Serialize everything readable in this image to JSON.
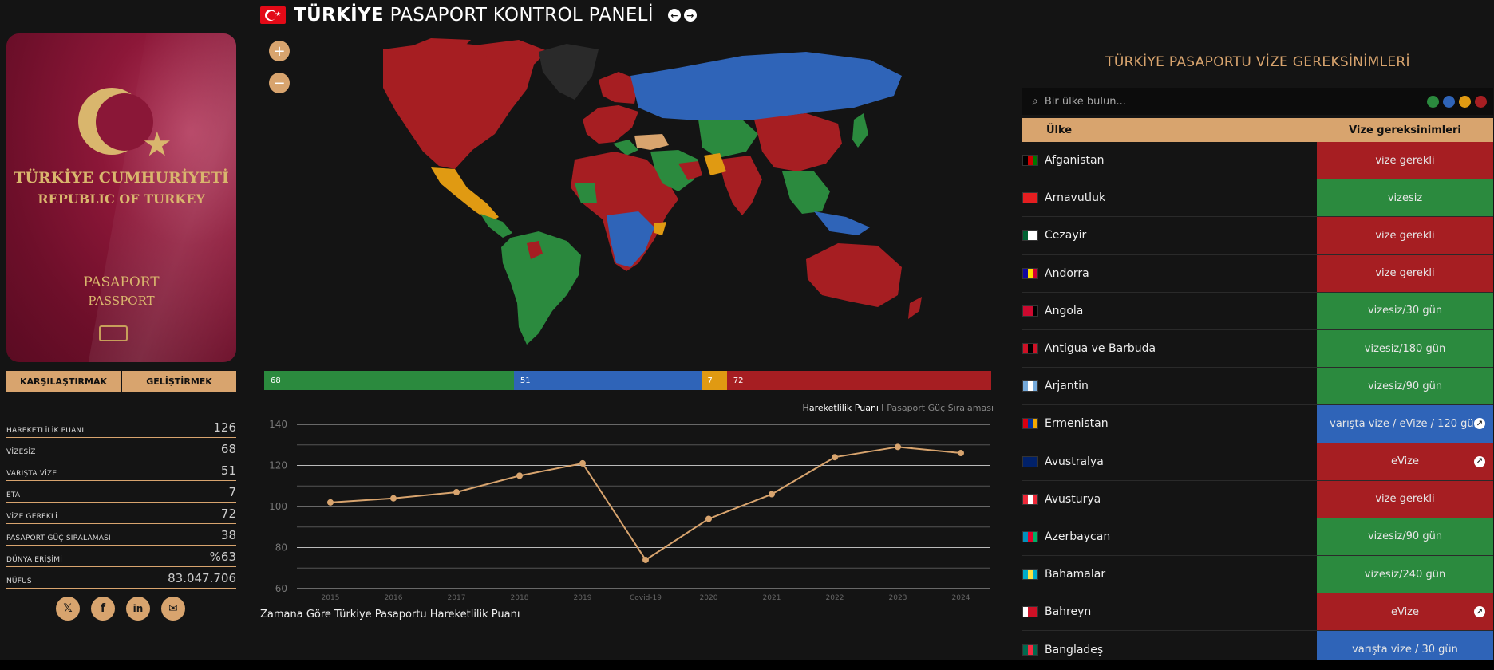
{
  "header": {
    "title_bold": "TÜRKİYE",
    "title_rest": "PASAPORT KONTROL PANELİ"
  },
  "passport": {
    "line1": "TÜRKİYE CUMHURİYETİ",
    "line2": "REPUBLIC OF TURKEY",
    "line3": "PASAPORT",
    "line4": "PASSPORT"
  },
  "actions": {
    "compare": "KARŞILAŞTIRMAK",
    "improve": "GELİŞTİRMEK"
  },
  "stats": [
    {
      "label": "HAREKETLİLİK PUANI",
      "value": "126"
    },
    {
      "label": "VİZESİZ",
      "value": "68"
    },
    {
      "label": "VARIŞTA VİZE",
      "value": "51"
    },
    {
      "label": "ETA",
      "value": "7"
    },
    {
      "label": "VİZE GEREKLİ",
      "value": "72"
    },
    {
      "label": "PASAPORT GÜÇ SIRALAMASI",
      "value": "38"
    },
    {
      "label": "DÜNYA ERİŞİMİ",
      "value": "%63"
    },
    {
      "label": "NÜFUS",
      "value": "83.047.706"
    }
  ],
  "socials": [
    "x-icon",
    "facebook-icon",
    "linkedin-icon",
    "mail-icon"
  ],
  "map": {
    "zoom_in": "+",
    "zoom_out": "−"
  },
  "breakdown": [
    {
      "label": "68",
      "value": 68,
      "color": "#2b8a3e"
    },
    {
      "label": "51",
      "value": 51,
      "color": "#2f64b8"
    },
    {
      "label": "7",
      "value": 7,
      "color": "#e09a12"
    },
    {
      "label": "72",
      "value": 72,
      "color": "#a61e22"
    }
  ],
  "chart_legend": {
    "active": "Hareketlilik Puanı",
    "separator": " I ",
    "inactive": "Pasaport Güç Sıralaması"
  },
  "chart_caption": "Zamana Göre Türkiye Pasaportu Hareketlilik Puanı",
  "chart_data": {
    "type": "line",
    "categories": [
      "2015",
      "2016",
      "2017",
      "2018",
      "2019",
      "Covid-19",
      "2020",
      "2021",
      "2022",
      "2023",
      "2024"
    ],
    "series": [
      {
        "values": [
          102,
          104,
          107,
          115,
          121,
          74,
          94,
          106,
          124,
          129,
          126
        ]
      }
    ],
    "ylim": [
      60,
      140
    ],
    "yticks": [
      60,
      80,
      100,
      120,
      140
    ],
    "grid": true,
    "color": "#d8a46e"
  },
  "table": {
    "title": "TÜRKİYE PASAPORTU VİZE GEREKSİNİMLERİ",
    "search_placeholder": "Bir ülke bulun...",
    "filter_colors": [
      "#2b8a3e",
      "#2f64b8",
      "#e09a12",
      "#a61e22"
    ],
    "col_country": "Ülke",
    "col_visa": "Vize gereksinimleri",
    "rows": [
      {
        "country": "Afganistan",
        "visa": "vize gerekli",
        "color": "#a61e22",
        "ext": false,
        "flag": [
          "#000",
          "#c00",
          "#070"
        ]
      },
      {
        "country": "Arnavutluk",
        "visa": "vizesiz",
        "color": "#2b8a3e",
        "ext": false,
        "flag": [
          "#e41e20",
          "#e41e20",
          "#e41e20"
        ]
      },
      {
        "country": "Cezayir",
        "visa": "vize gerekli",
        "color": "#a61e22",
        "ext": false,
        "flag": [
          "#006233",
          "#fff",
          "#fff"
        ]
      },
      {
        "country": "Andorra",
        "visa": "vize gerekli",
        "color": "#a61e22",
        "ext": false,
        "flag": [
          "#10069f",
          "#fedd00",
          "#d50032"
        ]
      },
      {
        "country": "Angola",
        "visa": "vizesiz/30 gün",
        "color": "#2b8a3e",
        "ext": false,
        "flag": [
          "#cc092f",
          "#cc092f",
          "#000"
        ]
      },
      {
        "country": "Antigua ve Barbuda",
        "visa": "vizesiz/180 gün",
        "color": "#2b8a3e",
        "ext": false,
        "flag": [
          "#ce1126",
          "#000",
          "#ce1126"
        ]
      },
      {
        "country": "Arjantin",
        "visa": "vizesiz/90 gün",
        "color": "#2b8a3e",
        "ext": false,
        "flag": [
          "#75aadb",
          "#fff",
          "#75aadb"
        ]
      },
      {
        "country": "Ermenistan",
        "visa": "varışta vize / eVize / 120 gün",
        "color": "#2f64b8",
        "ext": true,
        "flag": [
          "#d90012",
          "#0033a0",
          "#f2a800"
        ]
      },
      {
        "country": "Avustralya",
        "visa": "eVize",
        "color": "#a61e22",
        "ext": true,
        "flag": [
          "#012169",
          "#012169",
          "#012169"
        ]
      },
      {
        "country": "Avusturya",
        "visa": "vize gerekli",
        "color": "#a61e22",
        "ext": false,
        "flag": [
          "#ed2939",
          "#fff",
          "#ed2939"
        ]
      },
      {
        "country": "Azerbaycan",
        "visa": "vizesiz/90 gün",
        "color": "#2b8a3e",
        "ext": false,
        "flag": [
          "#0092bc",
          "#e4002b",
          "#00af66"
        ]
      },
      {
        "country": "Bahamalar",
        "visa": "vizesiz/240 gün",
        "color": "#2b8a3e",
        "ext": false,
        "flag": [
          "#00abc9",
          "#fae042",
          "#00abc9"
        ]
      },
      {
        "country": "Bahreyn",
        "visa": "eVize",
        "color": "#a61e22",
        "ext": true,
        "flag": [
          "#fff",
          "#ce1126",
          "#ce1126"
        ]
      },
      {
        "country": "Bangladeş",
        "visa": "varışta vize / 30 gün",
        "color": "#2f64b8",
        "ext": false,
        "flag": [
          "#006a4e",
          "#f42a41",
          "#006a4e"
        ]
      }
    ]
  }
}
